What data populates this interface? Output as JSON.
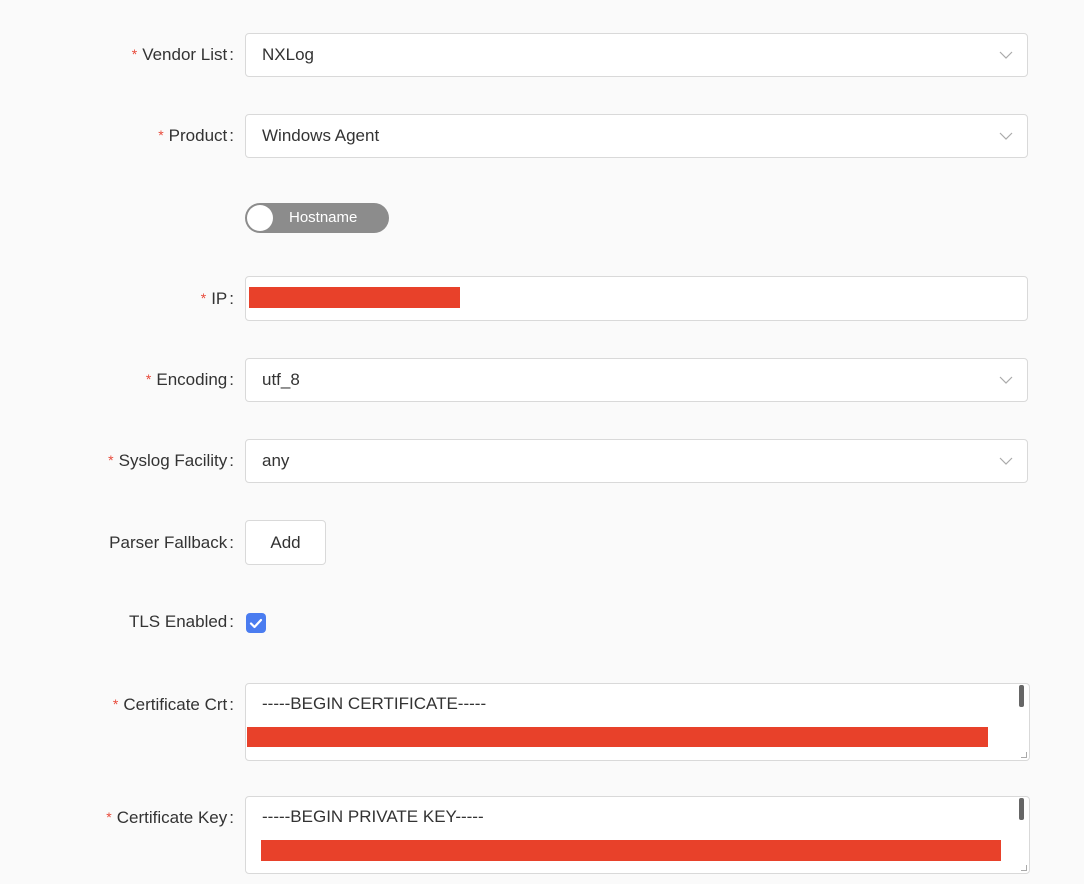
{
  "form": {
    "vendor": {
      "label": "Vendor List",
      "value": "NXLog"
    },
    "product": {
      "label": "Product",
      "value": "Windows Agent"
    },
    "hostname_toggle": {
      "label": "Hostname",
      "on": false
    },
    "ip": {
      "label": "IP"
    },
    "encoding": {
      "label": "Encoding",
      "value": "utf_8"
    },
    "syslog_facility": {
      "label": "Syslog Facility",
      "value": "any"
    },
    "parser_fallback": {
      "label": "Parser Fallback",
      "button": "Add"
    },
    "tls": {
      "label": "TLS Enabled",
      "checked": true
    },
    "cert_crt": {
      "label": "Certificate Crt",
      "first_line": "-----BEGIN CERTIFICATE-----"
    },
    "cert_key": {
      "label": "Certificate Key",
      "first_line": "-----BEGIN PRIVATE KEY-----"
    },
    "colon": ":",
    "required_mark": "*"
  },
  "colors": {
    "required": "#e84a3b",
    "redaction": "#e8412a",
    "checkbox": "#4a7cf0",
    "toggle_off": "#8c8c8c"
  }
}
